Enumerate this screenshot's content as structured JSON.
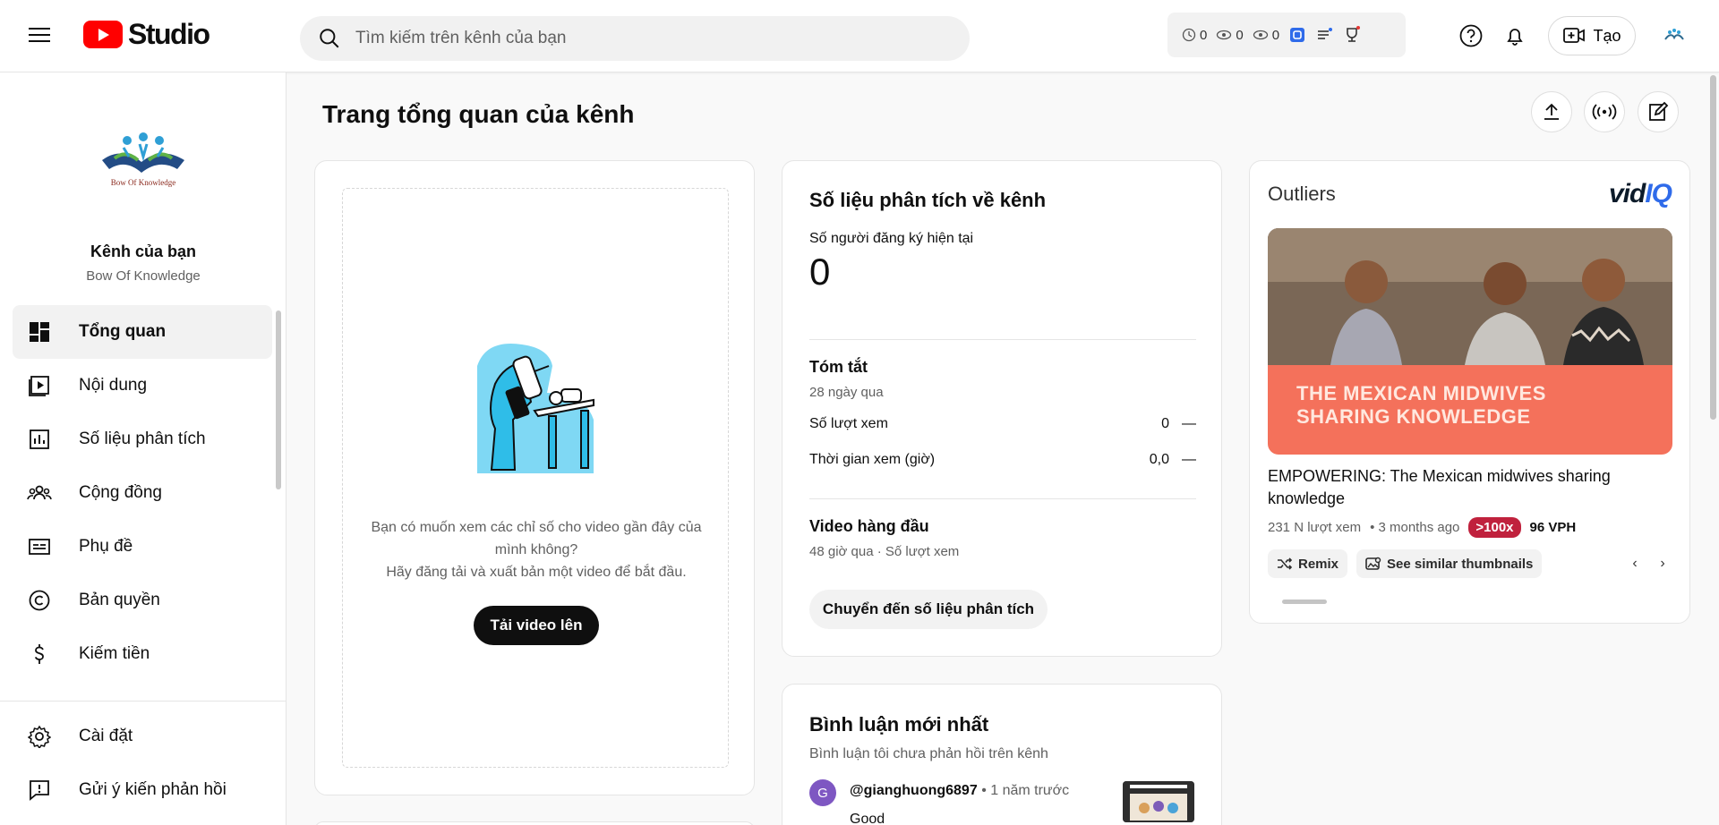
{
  "header": {
    "logo_text": "Studio",
    "search_placeholder": "Tìm kiếm trên kênh của bạn",
    "stats": [
      "0",
      "0",
      "0"
    ],
    "create_label": "Tạo"
  },
  "sidebar": {
    "logo_text": "Bow Of Knowledge",
    "channel_title": "Kênh của bạn",
    "channel_name": "Bow Of Knowledge",
    "items": [
      {
        "label": "Tổng quan",
        "icon": "dashboard-icon"
      },
      {
        "label": "Nội dung",
        "icon": "content-icon"
      },
      {
        "label": "Số liệu phân tích",
        "icon": "analytics-icon"
      },
      {
        "label": "Cộng đồng",
        "icon": "community-icon"
      },
      {
        "label": "Phụ đề",
        "icon": "subtitles-icon"
      },
      {
        "label": "Bản quyền",
        "icon": "copyright-icon"
      },
      {
        "label": "Kiếm tiền",
        "icon": "monetization-icon"
      }
    ],
    "bottom_items": [
      {
        "label": "Cài đặt",
        "icon": "gear-icon"
      },
      {
        "label": "Gửi ý kiến phản hồi",
        "icon": "feedback-icon"
      }
    ]
  },
  "main": {
    "page_title": "Trang tổng quan của kênh",
    "upload_card": {
      "text_line1": "Bạn có muốn xem các chỉ số cho video gần đây của",
      "text_line2": "mình không?",
      "text_line3": "Hãy đăng tải và xuất bản một video để bắt đầu.",
      "button": "Tải video lên"
    },
    "analytics_card": {
      "title": "Số liệu phân tích về kênh",
      "subscribers_label": "Số người đăng ký hiện tại",
      "subscribers_value": "0",
      "summary_title": "Tóm tắt",
      "summary_period": "28 ngày qua",
      "rows": [
        {
          "label": "Số lượt xem",
          "value": "0",
          "trend": "—"
        },
        {
          "label": "Thời gian xem (giờ)",
          "value": "0,0",
          "trend": "—"
        }
      ],
      "top_videos_title": "Video hàng đầu",
      "top_videos_sub": "48 giờ qua · Số lượt xem",
      "button": "Chuyển đến số liệu phân tích"
    },
    "comments_card": {
      "title": "Bình luận mới nhất",
      "subtitle": "Bình luận tôi chưa phản hồi trên kênh",
      "comment": {
        "avatar_letter": "G",
        "user": "@gianghuong6897",
        "time": "• 1 năm trước",
        "text": "Good"
      }
    },
    "outliers_card": {
      "title": "Outliers",
      "brand_a": "vid",
      "brand_b": "IQ",
      "thumb_line1": "THE MEXICAN MIDWIVES",
      "thumb_line2": "SHARING KNOWLEDGE",
      "video_title": "EMPOWERING: The Mexican midwives sharing knowledge",
      "views": "231 N lượt xem",
      "age": "• 3 months ago",
      "badge": ">100x",
      "vph": "96 VPH",
      "chip_remix": "Remix",
      "chip_similar": "See similar thumbnails",
      "prev": "‹",
      "next": "›"
    }
  }
}
